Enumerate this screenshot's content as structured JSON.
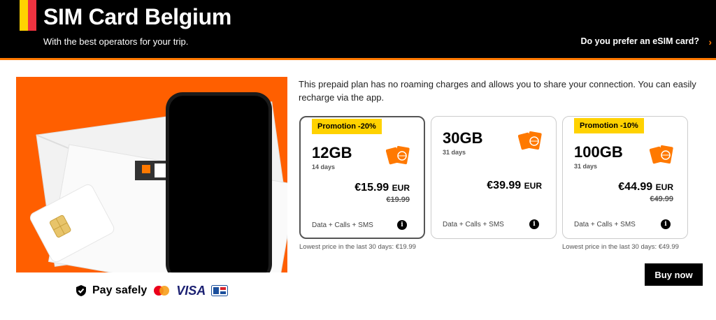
{
  "header": {
    "title": "SIM Card Belgium",
    "subtitle": "With the best operators for your trip.",
    "esim_link": "Do you prefer an eSIM card?",
    "flag_colors": [
      "#000000",
      "#ffd200",
      "#ef3340"
    ]
  },
  "hero": {
    "background_color": "#ff5f00",
    "icon": "sim-card-phone-illustration"
  },
  "payment": {
    "label": "Pay safely",
    "visa": "VISA",
    "icons": [
      "shield-check-icon",
      "mastercard-icon",
      "visa-icon",
      "cb-card-icon"
    ]
  },
  "description": "This prepaid plan has no roaming charges and allows you to share your connection. You can easily recharge via the app.",
  "plans": [
    {
      "promo": "Promotion -20%",
      "data": "12GB",
      "days": "14 days",
      "price": "€15.99",
      "currency": "EUR",
      "old_price": "€19.99",
      "features": "Data + Calls + SMS",
      "lowest": "Lowest price in the last 30 days: €19.99",
      "selected": true
    },
    {
      "promo": "",
      "data": "30GB",
      "days": "31 days",
      "price": "€39.99",
      "currency": "EUR",
      "old_price": "",
      "features": "Data + Calls + SMS",
      "lowest": "",
      "selected": false
    },
    {
      "promo": "Promotion -10%",
      "data": "100GB",
      "days": "31 days",
      "price": "€44.99",
      "currency": "EUR",
      "old_price": "€49.99",
      "features": "Data + Calls + SMS",
      "lowest": "Lowest price in the last 30 days: €49.99",
      "selected": false
    }
  ],
  "buy_button": "Buy now",
  "colors": {
    "accent": "#ff7900",
    "promo": "#ffd200"
  }
}
